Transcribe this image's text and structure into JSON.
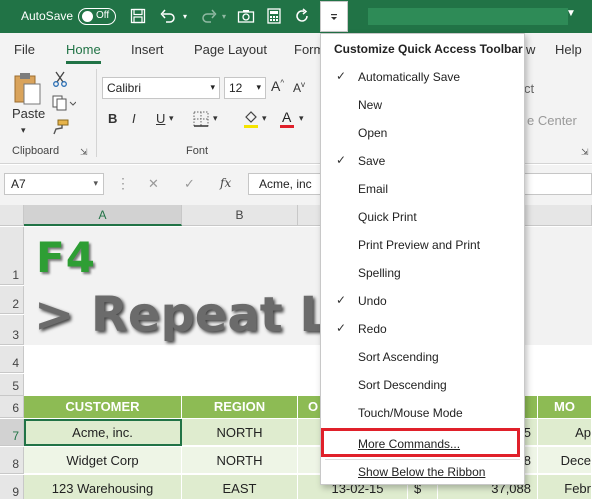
{
  "titlebar": {
    "autosave_label": "AutoSave",
    "autosave_state": "Off",
    "icons": [
      "save-icon",
      "undo-icon",
      "redo-icon",
      "camera-icon",
      "calculator-icon",
      "refresh-icon",
      "customize-dropdown-icon",
      "chevron-down-icon"
    ],
    "accent_color": "#217346"
  },
  "ribbon": {
    "tabs": [
      "File",
      "Home",
      "Insert",
      "Page Layout",
      "Form",
      "w",
      "Help"
    ],
    "active_tab": "Home",
    "clipboard": {
      "paste_label": "Paste",
      "group_label": "Clipboard"
    },
    "font": {
      "font_name": "Calibri",
      "font_size": "12",
      "grow": "A",
      "shrink": "A",
      "bold": "B",
      "italic": "I",
      "underline": "U",
      "font_color_glyph": "A",
      "group_label": "Font"
    },
    "alignment": {
      "wrap_fragment": "ct",
      "center_fragment": "e Center"
    }
  },
  "formula_bar": {
    "name_box": "A7",
    "fx": "fx",
    "cancel": "✕",
    "enter": "✓",
    "content": "Acme, inc"
  },
  "sheet": {
    "columns": [
      "A",
      "B"
    ],
    "rows": [
      "1",
      "2",
      "3",
      "4",
      "5",
      "6",
      "7",
      "8",
      "9"
    ],
    "banner_title": "F4",
    "banner_subtitle": "> Repeat Las",
    "header_row": [
      "CUSTOMER",
      "REGION",
      "O",
      "MO"
    ],
    "data_rows": [
      [
        "Acme, inc.",
        "NORTH",
        "5",
        "Ap"
      ],
      [
        "Widget Corp",
        "NORTH",
        "8",
        "Dece"
      ],
      [
        "123 Warehousing",
        "EAST",
        "13-02-15",
        "$",
        "37,088",
        "Febr"
      ]
    ]
  },
  "menu": {
    "title": "Customize Quick Access Toolbar",
    "items": [
      {
        "label": "Automatically Save",
        "checked": "✓"
      },
      {
        "label": "New",
        "checked": ""
      },
      {
        "label": "Open",
        "checked": ""
      },
      {
        "label": "Save",
        "checked": "✓"
      },
      {
        "label": "Email",
        "checked": ""
      },
      {
        "label": "Quick Print",
        "checked": ""
      },
      {
        "label": "Print Preview and Print",
        "checked": ""
      },
      {
        "label": "Spelling",
        "checked": ""
      },
      {
        "label": "Undo",
        "checked": "✓"
      },
      {
        "label": "Redo",
        "checked": "✓"
      },
      {
        "label": "Sort Ascending",
        "checked": ""
      },
      {
        "label": "Sort Descending",
        "checked": ""
      },
      {
        "label": "Touch/Mouse Mode",
        "checked": ""
      }
    ],
    "more_commands": "More Commands...",
    "show_below": "Show Below the Ribbon",
    "highlight_color": "#e0202a"
  }
}
